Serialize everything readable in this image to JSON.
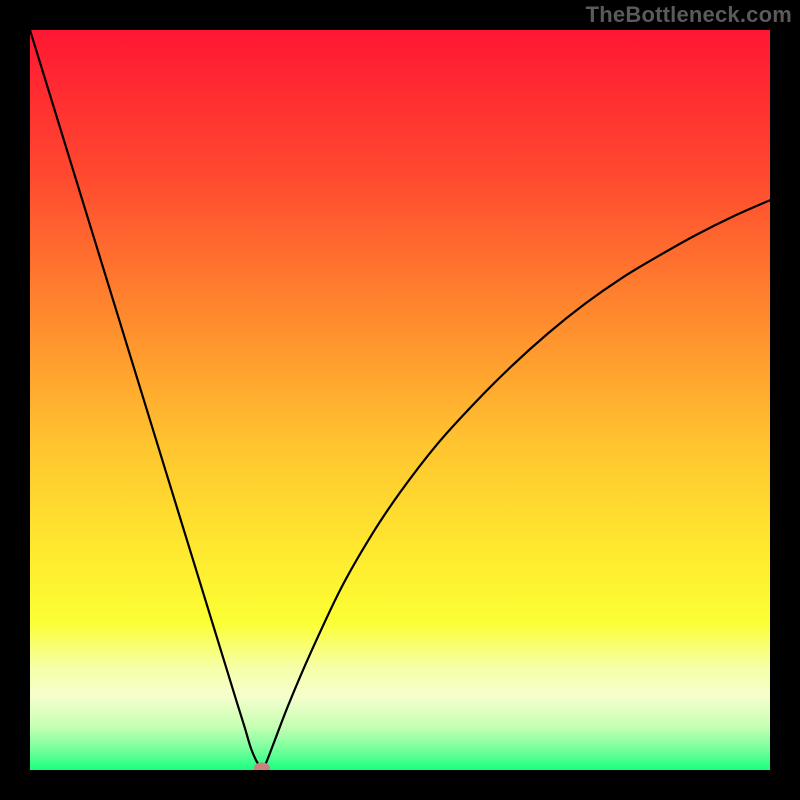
{
  "watermark": "TheBottleneck.com",
  "chart_data": {
    "type": "line",
    "title": "",
    "xlabel": "",
    "ylabel": "",
    "xlim": [
      0,
      100
    ],
    "ylim": [
      0,
      100
    ],
    "grid": false,
    "legend": false,
    "gradient_stops": [
      {
        "pos": 0.0,
        "color": "#ff1733"
      },
      {
        "pos": 0.2,
        "color": "#ff4a2f"
      },
      {
        "pos": 0.4,
        "color": "#ff8e2e"
      },
      {
        "pos": 0.56,
        "color": "#ffc42f"
      },
      {
        "pos": 0.7,
        "color": "#ffe82f"
      },
      {
        "pos": 0.8,
        "color": "#fbff34"
      },
      {
        "pos": 0.86,
        "color": "#f6ffa5"
      },
      {
        "pos": 0.9,
        "color": "#f6ffcd"
      },
      {
        "pos": 0.94,
        "color": "#c8ffb5"
      },
      {
        "pos": 0.97,
        "color": "#7dff9e"
      },
      {
        "pos": 1.0,
        "color": "#1aff80"
      }
    ],
    "series": [
      {
        "name": "bottleneck-curve",
        "color": "#000000",
        "x": [
          0.0,
          2.0,
          4.0,
          6.0,
          8.0,
          10.0,
          12.0,
          14.0,
          16.0,
          18.0,
          20.0,
          22.0,
          24.0,
          26.0,
          28.0,
          29.0,
          29.8,
          30.5,
          31.0,
          31.3,
          31.6,
          32.0,
          33.0,
          35.0,
          38.0,
          42.0,
          46.0,
          50.0,
          55.0,
          60.0,
          65.0,
          70.0,
          75.0,
          80.0,
          85.0,
          90.0,
          95.0,
          100.0
        ],
        "values": [
          100.0,
          93.5,
          87.0,
          80.5,
          74.0,
          67.5,
          61.0,
          54.5,
          48.0,
          41.5,
          35.0,
          28.5,
          22.0,
          15.5,
          9.0,
          5.8,
          3.1,
          1.4,
          0.6,
          0.3,
          0.5,
          1.2,
          3.8,
          9.0,
          16.0,
          24.5,
          31.5,
          37.5,
          44.0,
          49.5,
          54.5,
          59.0,
          63.0,
          66.5,
          69.5,
          72.3,
          74.8,
          77.0
        ]
      }
    ],
    "marker": {
      "x": 31.3,
      "y": 0.3,
      "color": "#cd8080"
    }
  }
}
